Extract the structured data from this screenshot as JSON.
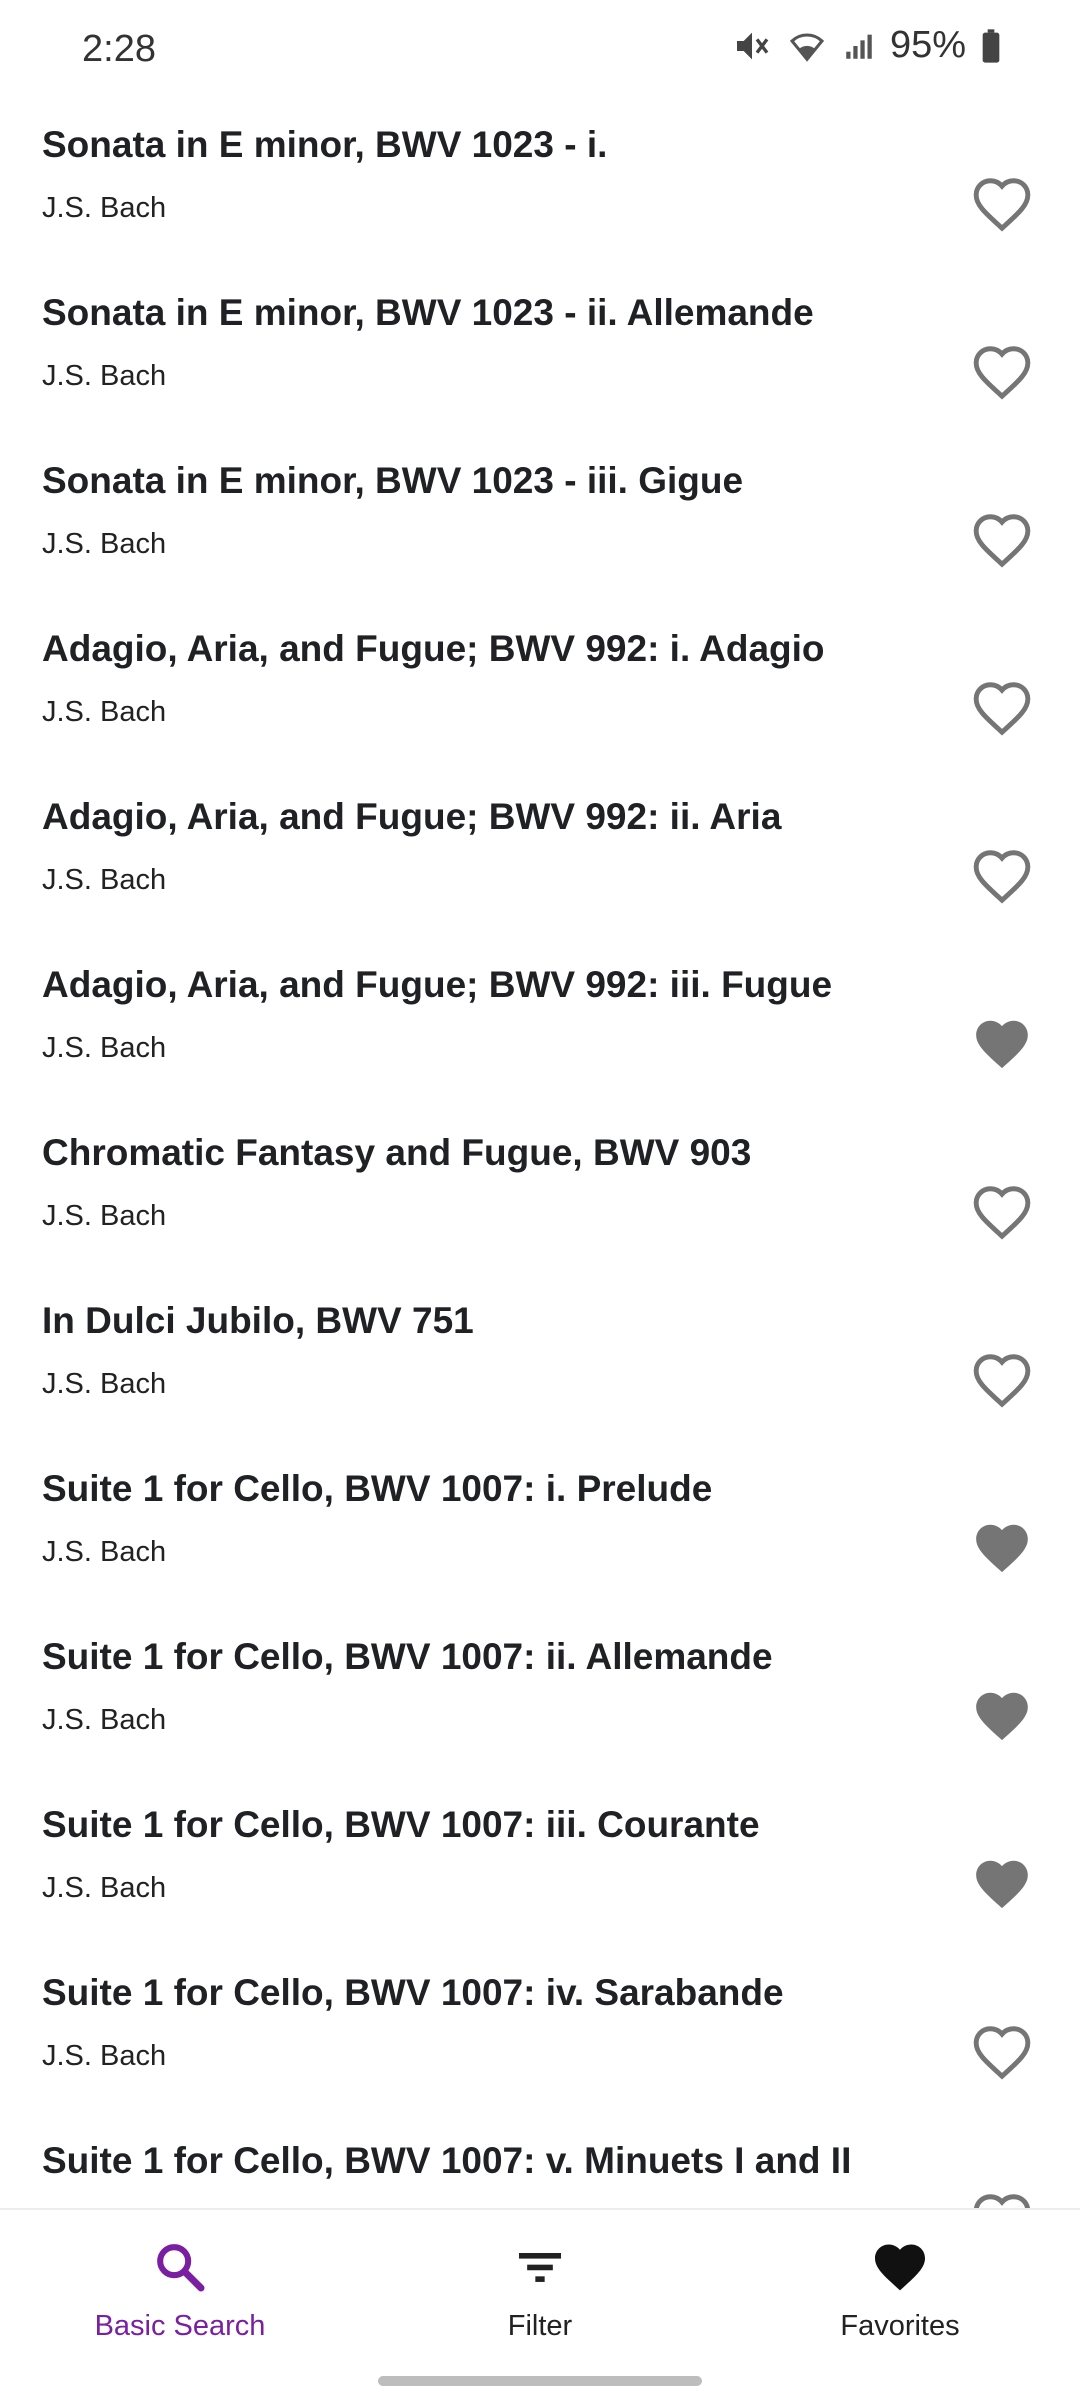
{
  "status_bar": {
    "time": "2:28",
    "battery": "95%",
    "icons": [
      "mute-icon",
      "wifi-icon",
      "signal-icon",
      "battery-icon"
    ]
  },
  "colors": {
    "accent": "#7b1fa2",
    "heart": "#757575"
  },
  "artist": "J.S. Bach",
  "items": [
    {
      "title": "Sonata in E minor, BWV 1023 - i.",
      "artist": "J.S. Bach",
      "favorite": false
    },
    {
      "title": "Sonata in E minor, BWV 1023 - ii. Allemande",
      "artist": "J.S. Bach",
      "favorite": false
    },
    {
      "title": "Sonata in E minor, BWV 1023 - iii.  Gigue",
      "artist": "J.S. Bach",
      "favorite": false
    },
    {
      "title": "Adagio, Aria, and Fugue; BWV 992: i. Adagio",
      "artist": "J.S. Bach",
      "favorite": false
    },
    {
      "title": "Adagio, Aria, and Fugue; BWV 992: ii. Aria",
      "artist": "J.S. Bach",
      "favorite": false
    },
    {
      "title": "Adagio, Aria, and Fugue; BWV 992: iii. Fugue",
      "artist": "J.S. Bach",
      "favorite": true
    },
    {
      "title": "Chromatic Fantasy and Fugue, BWV 903",
      "artist": "J.S. Bach",
      "favorite": false
    },
    {
      "title": "In Dulci Jubilo, BWV 751",
      "artist": "J.S. Bach",
      "favorite": false
    },
    {
      "title": "Suite 1 for Cello, BWV 1007: i. Prelude",
      "artist": "J.S. Bach",
      "favorite": true
    },
    {
      "title": "Suite 1 for Cello, BWV 1007: ii.  Allemande",
      "artist": "J.S. Bach",
      "favorite": true
    },
    {
      "title": "Suite 1 for Cello, BWV 1007: iii.  Courante",
      "artist": "J.S. Bach",
      "favorite": true
    },
    {
      "title": "Suite 1 for Cello, BWV 1007: iv.  Sarabande",
      "artist": "J.S. Bach",
      "favorite": false
    },
    {
      "title": "Suite 1 for Cello, BWV 1007: v. Minuets I and II",
      "artist": "",
      "favorite": false
    }
  ],
  "bottom_nav": {
    "items": [
      {
        "label": "Basic Search",
        "icon": "search-icon",
        "active": true
      },
      {
        "label": "Filter",
        "icon": "filter-icon",
        "active": false
      },
      {
        "label": "Favorites",
        "icon": "heart-icon",
        "active": false
      }
    ]
  }
}
